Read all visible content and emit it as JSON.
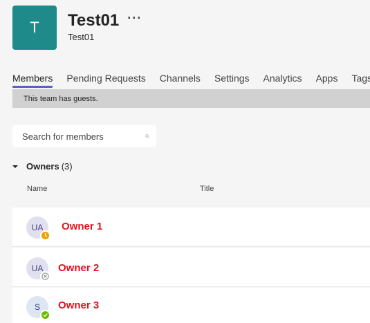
{
  "team": {
    "avatar_letter": "T",
    "name": "Test01",
    "more_label": "···",
    "subtitle": "Test01",
    "color": "#1f8a8a"
  },
  "tabs": [
    {
      "label": "Members",
      "active": true
    },
    {
      "label": "Pending Requests",
      "active": false
    },
    {
      "label": "Channels",
      "active": false
    },
    {
      "label": "Settings",
      "active": false
    },
    {
      "label": "Analytics",
      "active": false
    },
    {
      "label": "Apps",
      "active": false
    },
    {
      "label": "Tags",
      "active": false
    }
  ],
  "banner": {
    "text": "This team has guests."
  },
  "search": {
    "placeholder": "Search for members",
    "value": "",
    "icon": "search-icon"
  },
  "owners": {
    "title": "Owners",
    "count": "(3)",
    "columns": {
      "name": "Name",
      "title": "Title"
    },
    "members": [
      {
        "initials": "UA",
        "name": "Owner 1",
        "presence": "away",
        "presence_color": "#eaa300"
      },
      {
        "initials": "UA",
        "name": "Owner 2",
        "presence": "offline",
        "presence_color": "#8a8a8a"
      },
      {
        "initials": "S",
        "name": "Owner 3",
        "presence": "available",
        "presence_color": "#6bb700"
      }
    ]
  },
  "colors": {
    "accent": "#5b5fc7",
    "highlight_name": "#e0121b",
    "banner_bg": "#d1d1d1"
  }
}
